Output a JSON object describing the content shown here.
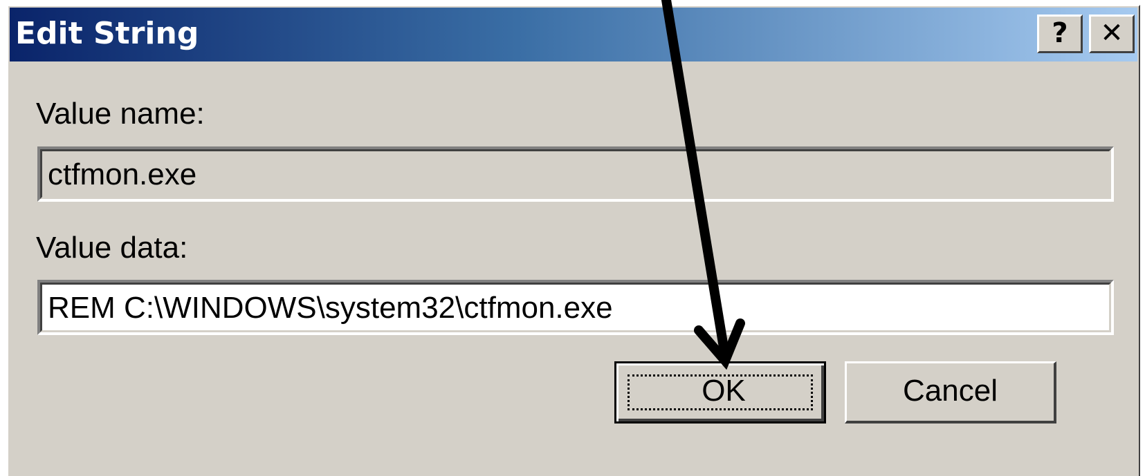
{
  "dialog": {
    "title": "Edit String",
    "help_button": "?",
    "close_button": "✕"
  },
  "value_name": {
    "label": "Value name:",
    "value": "ctfmon.exe"
  },
  "value_data": {
    "label": "Value data:",
    "value": "REM C:\\WINDOWS\\system32\\ctfmon.exe"
  },
  "buttons": {
    "ok": "OK",
    "cancel": "Cancel"
  },
  "colors": {
    "title_gradient_start": "#0a246a",
    "title_gradient_end": "#a6caf0",
    "dialog_face": "#d4d0c8",
    "annotation_arrow": "#000000"
  }
}
